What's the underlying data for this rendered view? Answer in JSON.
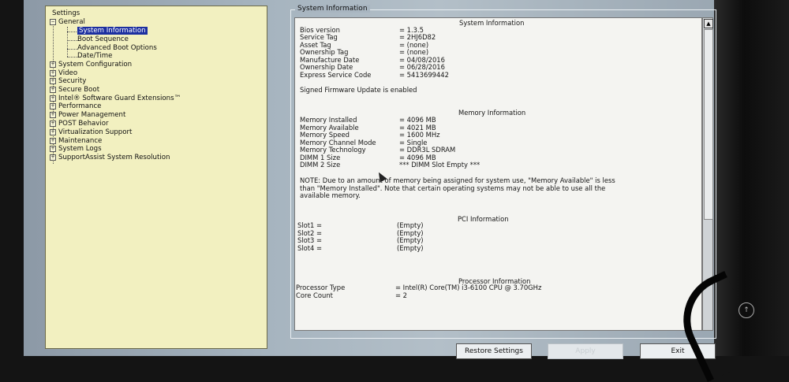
{
  "tree": {
    "title": "Settings",
    "items": [
      {
        "label": "General",
        "expander": "−",
        "level": 0
      },
      {
        "label": "System Information",
        "level": 1,
        "selected": true
      },
      {
        "label": "Boot Sequence",
        "level": 1
      },
      {
        "label": "Advanced Boot Options",
        "level": 1
      },
      {
        "label": "Date/Time",
        "level": 1
      },
      {
        "label": "System Configuration",
        "expander": "+",
        "level": 0
      },
      {
        "label": "Video",
        "expander": "+",
        "level": 0
      },
      {
        "label": "Security",
        "expander": "+",
        "level": 0
      },
      {
        "label": "Secure Boot",
        "expander": "+",
        "level": 0
      },
      {
        "label": "Intel® Software Guard Extensions™",
        "expander": "+",
        "level": 0
      },
      {
        "label": "Performance",
        "expander": "+",
        "level": 0
      },
      {
        "label": "Power Management",
        "expander": "+",
        "level": 0
      },
      {
        "label": "POST Behavior",
        "expander": "+",
        "level": 0
      },
      {
        "label": "Virtualization Support",
        "expander": "+",
        "level": 0
      },
      {
        "label": "Maintenance",
        "expander": "+",
        "level": 0
      },
      {
        "label": "System Logs",
        "expander": "+",
        "level": 0
      },
      {
        "label": "SupportAssist System Resolution",
        "expander": "+",
        "level": 0
      }
    ]
  },
  "info": {
    "group_title": "System Information",
    "system": {
      "heading": "System Information",
      "rows": [
        {
          "label": "Bios version",
          "value": "= 1.3.5"
        },
        {
          "label": "Service Tag",
          "value": "= 2HJ6D82"
        },
        {
          "label": "Asset Tag",
          "value": "= (none)"
        },
        {
          "label": "Ownership Tag",
          "value": "= (none)"
        },
        {
          "label": "Manufacture Date",
          "value": "= 04/08/2016"
        },
        {
          "label": "Ownership Date",
          "value": "= 06/28/2016"
        },
        {
          "label": "Express Service Code",
          "value": "= 5413699442"
        }
      ],
      "firmware_note": "Signed Firmware Update is enabled"
    },
    "memory": {
      "heading": "Memory Information",
      "rows": [
        {
          "label": "Memory Installed",
          "value": "= 4096 MB"
        },
        {
          "label": "Memory Available",
          "value": "= 4021 MB"
        },
        {
          "label": "Memory Speed",
          "value": "= 1600 MHz"
        },
        {
          "label": "Memory Channel Mode",
          "value": "= Single"
        },
        {
          "label": "Memory Technology",
          "value": "= DDR3L SDRAM"
        },
        {
          "label": "DIMM 1 Size",
          "value": "= 4096 MB"
        },
        {
          "label": "DIMM 2 Size",
          "value": "*** DIMM Slot Empty ***"
        }
      ],
      "note_lines": [
        "NOTE: Due to an amount of memory being assigned for system use, \"Memory Available\" is less",
        "than \"Memory Installed\". Note that certain operating systems may not be able to use all the",
        "available memory."
      ]
    },
    "pci": {
      "heading": "PCI Information",
      "rows": [
        {
          "label": "Slot1 =",
          "value": "(Empty)"
        },
        {
          "label": "Slot2 =",
          "value": "(Empty)"
        },
        {
          "label": "Slot3 =",
          "value": "(Empty)"
        },
        {
          "label": "Slot4 =",
          "value": "(Empty)"
        }
      ]
    },
    "processor": {
      "heading": "Processor Information",
      "rows": [
        {
          "label": "Processor Type",
          "value": "= Intel(R) Core(TM) i3-6100 CPU @ 3.70GHz"
        },
        {
          "label": "Core Count",
          "value": "= 2"
        }
      ]
    }
  },
  "buttons": {
    "restore": "Restore Settings",
    "apply": "Apply",
    "exit": "Exit"
  },
  "scrollbar": {
    "up_arrow": "▲"
  },
  "side_icon": "↑"
}
